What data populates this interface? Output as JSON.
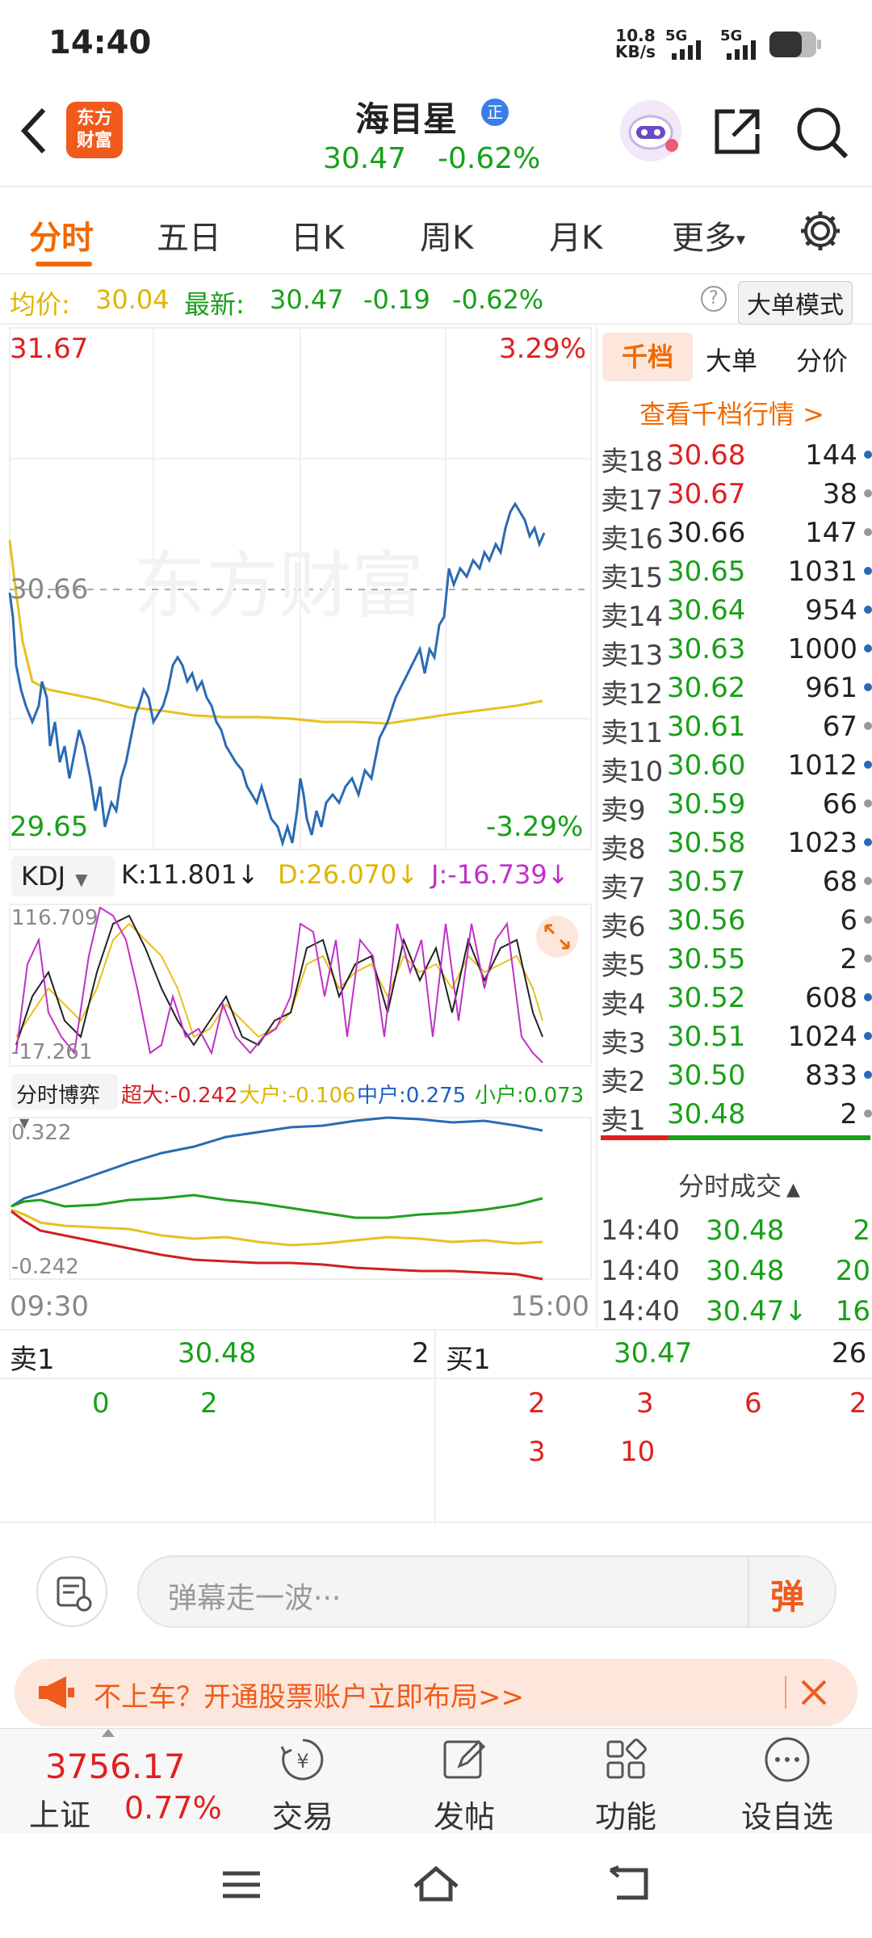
{
  "status_bar": {
    "time": "14:40",
    "net_speed_value": "10.8",
    "net_speed_unit": "KB/s",
    "sig1": "5G",
    "sig2": "5G"
  },
  "header": {
    "logo_line1": "东方",
    "logo_line2": "财富",
    "stock_name": "海目星",
    "badge": "正",
    "price": "30.47",
    "change_pct": "-0.62%"
  },
  "tabs": [
    {
      "label": "分时"
    },
    {
      "label": "五日"
    },
    {
      "label": "日K"
    },
    {
      "label": "周K"
    },
    {
      "label": "月K"
    },
    {
      "label": "更多"
    }
  ],
  "summary": {
    "avg_label": "均价:",
    "avg_value": "30.04",
    "latest_label": "最新:",
    "latest_value": "30.47",
    "change": "-0.19",
    "change_pct": "-0.62%",
    "help": "?",
    "mode_button": "大单模式"
  },
  "price_chart": {
    "high": "31.67",
    "high_pct": "3.29%",
    "low": "29.65",
    "low_pct": "-3.29%",
    "prev_close": "30.66",
    "watermark": "东方财富"
  },
  "kdj": {
    "selector": "KDJ",
    "k": "K:11.801↓",
    "d": "D:26.070↓",
    "j": "J:-16.739↓",
    "max": "116.709",
    "min": "-17.261"
  },
  "game": {
    "selector": "分时博弈",
    "super_large": "超大:-0.242",
    "large": "大户:-0.106",
    "medium": "中户:0.275",
    "small": "小户:0.073",
    "max": "0.322",
    "min": "-0.242"
  },
  "time_axis": {
    "start": "09:30",
    "end": "15:00"
  },
  "orderbook": {
    "tabs": [
      "千档",
      "大单",
      "分价"
    ],
    "view_more": "查看千档行情 >",
    "asks": [
      {
        "label": "卖18",
        "price": "30.68",
        "vol": "144",
        "color": "red",
        "dot": "blue"
      },
      {
        "label": "卖17",
        "price": "30.67",
        "vol": "38",
        "color": "red",
        "dot": "gray"
      },
      {
        "label": "卖16",
        "price": "30.66",
        "vol": "147",
        "color": "black",
        "dot": "gray"
      },
      {
        "label": "卖15",
        "price": "30.65",
        "vol": "1031",
        "color": "green",
        "dot": "blue"
      },
      {
        "label": "卖14",
        "price": "30.64",
        "vol": "954",
        "color": "green",
        "dot": "blue"
      },
      {
        "label": "卖13",
        "price": "30.63",
        "vol": "1000",
        "color": "green",
        "dot": "blue"
      },
      {
        "label": "卖12",
        "price": "30.62",
        "vol": "961",
        "color": "green",
        "dot": "blue"
      },
      {
        "label": "卖11",
        "price": "30.61",
        "vol": "67",
        "color": "green",
        "dot": "gray"
      },
      {
        "label": "卖10",
        "price": "30.60",
        "vol": "1012",
        "color": "green",
        "dot": "blue"
      },
      {
        "label": "卖9",
        "price": "30.59",
        "vol": "66",
        "color": "green",
        "dot": "gray"
      },
      {
        "label": "卖8",
        "price": "30.58",
        "vol": "1023",
        "color": "green",
        "dot": "blue"
      },
      {
        "label": "卖7",
        "price": "30.57",
        "vol": "68",
        "color": "green",
        "dot": "gray"
      },
      {
        "label": "卖6",
        "price": "30.56",
        "vol": "6",
        "color": "green",
        "dot": "gray"
      },
      {
        "label": "卖5",
        "price": "30.55",
        "vol": "2",
        "color": "green",
        "dot": "gray"
      },
      {
        "label": "卖4",
        "price": "30.52",
        "vol": "608",
        "color": "green",
        "dot": "blue"
      },
      {
        "label": "卖3",
        "price": "30.51",
        "vol": "1024",
        "color": "green",
        "dot": "blue"
      },
      {
        "label": "卖2",
        "price": "30.50",
        "vol": "833",
        "color": "green",
        "dot": "blue"
      },
      {
        "label": "卖1",
        "price": "30.48",
        "vol": "2",
        "color": "green",
        "dot": "gray"
      }
    ],
    "trades_title": "分时成交",
    "trades": [
      {
        "time": "14:40",
        "price": "30.48",
        "vol": "2"
      },
      {
        "time": "14:40",
        "price": "30.48",
        "vol": "20"
      },
      {
        "time": "14:40",
        "price": "30.47↓",
        "vol": "16"
      }
    ]
  },
  "depth": {
    "sell": {
      "label": "卖1",
      "price": "30.48",
      "vol": "2",
      "orders": [
        "0",
        "2"
      ]
    },
    "buy": {
      "label": "买1",
      "price": "30.47",
      "vol": "26",
      "orders_row1": [
        "2",
        "3",
        "6",
        "2"
      ],
      "orders_row2": [
        "3",
        "10"
      ]
    }
  },
  "danmu": {
    "placeholder": "弹幕走一波···",
    "send": "弹"
  },
  "promo": {
    "text": "不上车？开通股票账户立即布局>>"
  },
  "bottom_nav": {
    "index_value": "3756.17",
    "index_name": "上证",
    "index_change": "0.77%",
    "items": [
      "交易",
      "发帖",
      "功能",
      "设自选"
    ]
  }
}
